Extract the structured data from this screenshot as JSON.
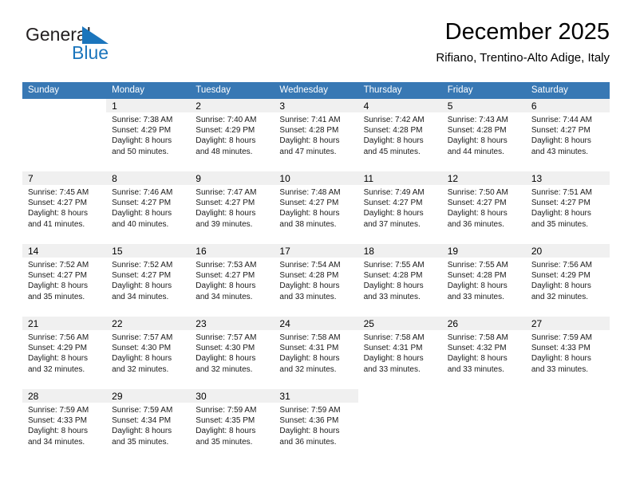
{
  "brand": {
    "line1": "General",
    "line2": "Blue",
    "mark": "triangle-logo",
    "accent_color": "#1b75bc"
  },
  "header": {
    "title": "December 2025",
    "subtitle": "Rifiano, Trentino-Alto Adige, Italy"
  },
  "calendar": {
    "header_color": "#3878b4",
    "daynum_band_color": "#f0f0f0",
    "rule_color": "#2e6da4",
    "weekdays": [
      "Sunday",
      "Monday",
      "Tuesday",
      "Wednesday",
      "Thursday",
      "Friday",
      "Saturday"
    ],
    "weeks": [
      [
        {
          "day": "",
          "sunrise": "",
          "sunset": "",
          "daylight1": "",
          "daylight2": "",
          "empty": true
        },
        {
          "day": "1",
          "sunrise": "Sunrise: 7:38 AM",
          "sunset": "Sunset: 4:29 PM",
          "daylight1": "Daylight: 8 hours",
          "daylight2": "and 50 minutes."
        },
        {
          "day": "2",
          "sunrise": "Sunrise: 7:40 AM",
          "sunset": "Sunset: 4:29 PM",
          "daylight1": "Daylight: 8 hours",
          "daylight2": "and 48 minutes."
        },
        {
          "day": "3",
          "sunrise": "Sunrise: 7:41 AM",
          "sunset": "Sunset: 4:28 PM",
          "daylight1": "Daylight: 8 hours",
          "daylight2": "and 47 minutes."
        },
        {
          "day": "4",
          "sunrise": "Sunrise: 7:42 AM",
          "sunset": "Sunset: 4:28 PM",
          "daylight1": "Daylight: 8 hours",
          "daylight2": "and 45 minutes."
        },
        {
          "day": "5",
          "sunrise": "Sunrise: 7:43 AM",
          "sunset": "Sunset: 4:28 PM",
          "daylight1": "Daylight: 8 hours",
          "daylight2": "and 44 minutes."
        },
        {
          "day": "6",
          "sunrise": "Sunrise: 7:44 AM",
          "sunset": "Sunset: 4:27 PM",
          "daylight1": "Daylight: 8 hours",
          "daylight2": "and 43 minutes."
        }
      ],
      [
        {
          "day": "7",
          "sunrise": "Sunrise: 7:45 AM",
          "sunset": "Sunset: 4:27 PM",
          "daylight1": "Daylight: 8 hours",
          "daylight2": "and 41 minutes."
        },
        {
          "day": "8",
          "sunrise": "Sunrise: 7:46 AM",
          "sunset": "Sunset: 4:27 PM",
          "daylight1": "Daylight: 8 hours",
          "daylight2": "and 40 minutes."
        },
        {
          "day": "9",
          "sunrise": "Sunrise: 7:47 AM",
          "sunset": "Sunset: 4:27 PM",
          "daylight1": "Daylight: 8 hours",
          "daylight2": "and 39 minutes."
        },
        {
          "day": "10",
          "sunrise": "Sunrise: 7:48 AM",
          "sunset": "Sunset: 4:27 PM",
          "daylight1": "Daylight: 8 hours",
          "daylight2": "and 38 minutes."
        },
        {
          "day": "11",
          "sunrise": "Sunrise: 7:49 AM",
          "sunset": "Sunset: 4:27 PM",
          "daylight1": "Daylight: 8 hours",
          "daylight2": "and 37 minutes."
        },
        {
          "day": "12",
          "sunrise": "Sunrise: 7:50 AM",
          "sunset": "Sunset: 4:27 PM",
          "daylight1": "Daylight: 8 hours",
          "daylight2": "and 36 minutes."
        },
        {
          "day": "13",
          "sunrise": "Sunrise: 7:51 AM",
          "sunset": "Sunset: 4:27 PM",
          "daylight1": "Daylight: 8 hours",
          "daylight2": "and 35 minutes."
        }
      ],
      [
        {
          "day": "14",
          "sunrise": "Sunrise: 7:52 AM",
          "sunset": "Sunset: 4:27 PM",
          "daylight1": "Daylight: 8 hours",
          "daylight2": "and 35 minutes."
        },
        {
          "day": "15",
          "sunrise": "Sunrise: 7:52 AM",
          "sunset": "Sunset: 4:27 PM",
          "daylight1": "Daylight: 8 hours",
          "daylight2": "and 34 minutes."
        },
        {
          "day": "16",
          "sunrise": "Sunrise: 7:53 AM",
          "sunset": "Sunset: 4:27 PM",
          "daylight1": "Daylight: 8 hours",
          "daylight2": "and 34 minutes."
        },
        {
          "day": "17",
          "sunrise": "Sunrise: 7:54 AM",
          "sunset": "Sunset: 4:28 PM",
          "daylight1": "Daylight: 8 hours",
          "daylight2": "and 33 minutes."
        },
        {
          "day": "18",
          "sunrise": "Sunrise: 7:55 AM",
          "sunset": "Sunset: 4:28 PM",
          "daylight1": "Daylight: 8 hours",
          "daylight2": "and 33 minutes."
        },
        {
          "day": "19",
          "sunrise": "Sunrise: 7:55 AM",
          "sunset": "Sunset: 4:28 PM",
          "daylight1": "Daylight: 8 hours",
          "daylight2": "and 33 minutes."
        },
        {
          "day": "20",
          "sunrise": "Sunrise: 7:56 AM",
          "sunset": "Sunset: 4:29 PM",
          "daylight1": "Daylight: 8 hours",
          "daylight2": "and 32 minutes."
        }
      ],
      [
        {
          "day": "21",
          "sunrise": "Sunrise: 7:56 AM",
          "sunset": "Sunset: 4:29 PM",
          "daylight1": "Daylight: 8 hours",
          "daylight2": "and 32 minutes."
        },
        {
          "day": "22",
          "sunrise": "Sunrise: 7:57 AM",
          "sunset": "Sunset: 4:30 PM",
          "daylight1": "Daylight: 8 hours",
          "daylight2": "and 32 minutes."
        },
        {
          "day": "23",
          "sunrise": "Sunrise: 7:57 AM",
          "sunset": "Sunset: 4:30 PM",
          "daylight1": "Daylight: 8 hours",
          "daylight2": "and 32 minutes."
        },
        {
          "day": "24",
          "sunrise": "Sunrise: 7:58 AM",
          "sunset": "Sunset: 4:31 PM",
          "daylight1": "Daylight: 8 hours",
          "daylight2": "and 32 minutes."
        },
        {
          "day": "25",
          "sunrise": "Sunrise: 7:58 AM",
          "sunset": "Sunset: 4:31 PM",
          "daylight1": "Daylight: 8 hours",
          "daylight2": "and 33 minutes."
        },
        {
          "day": "26",
          "sunrise": "Sunrise: 7:58 AM",
          "sunset": "Sunset: 4:32 PM",
          "daylight1": "Daylight: 8 hours",
          "daylight2": "and 33 minutes."
        },
        {
          "day": "27",
          "sunrise": "Sunrise: 7:59 AM",
          "sunset": "Sunset: 4:33 PM",
          "daylight1": "Daylight: 8 hours",
          "daylight2": "and 33 minutes."
        }
      ],
      [
        {
          "day": "28",
          "sunrise": "Sunrise: 7:59 AM",
          "sunset": "Sunset: 4:33 PM",
          "daylight1": "Daylight: 8 hours",
          "daylight2": "and 34 minutes."
        },
        {
          "day": "29",
          "sunrise": "Sunrise: 7:59 AM",
          "sunset": "Sunset: 4:34 PM",
          "daylight1": "Daylight: 8 hours",
          "daylight2": "and 35 minutes."
        },
        {
          "day": "30",
          "sunrise": "Sunrise: 7:59 AM",
          "sunset": "Sunset: 4:35 PM",
          "daylight1": "Daylight: 8 hours",
          "daylight2": "and 35 minutes."
        },
        {
          "day": "31",
          "sunrise": "Sunrise: 7:59 AM",
          "sunset": "Sunset: 4:36 PM",
          "daylight1": "Daylight: 8 hours",
          "daylight2": "and 36 minutes."
        },
        {
          "day": "",
          "sunrise": "",
          "sunset": "",
          "daylight1": "",
          "daylight2": "",
          "empty": true
        },
        {
          "day": "",
          "sunrise": "",
          "sunset": "",
          "daylight1": "",
          "daylight2": "",
          "empty": true
        },
        {
          "day": "",
          "sunrise": "",
          "sunset": "",
          "daylight1": "",
          "daylight2": "",
          "empty": true
        }
      ]
    ]
  }
}
